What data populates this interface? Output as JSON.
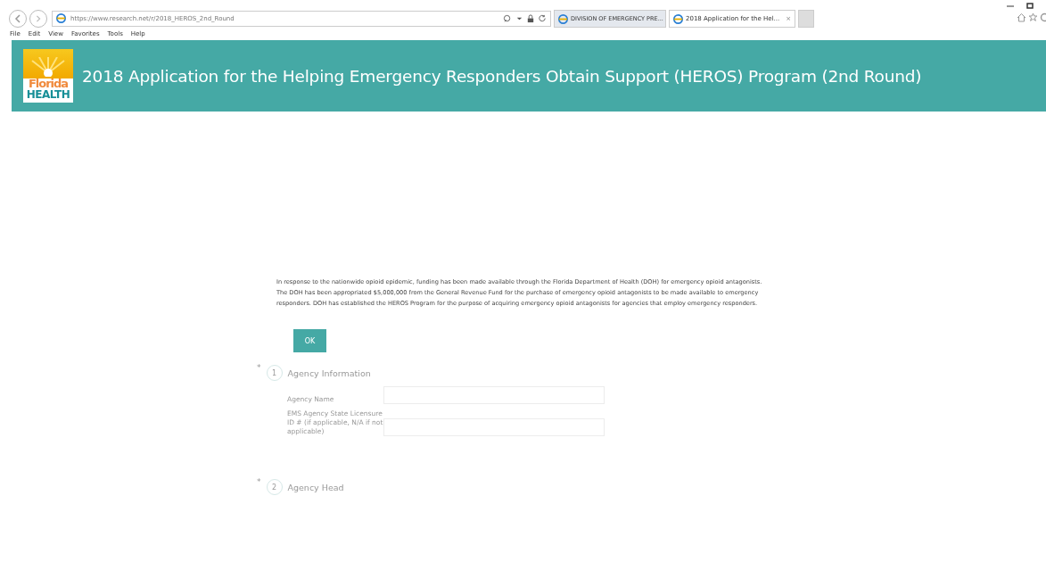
{
  "browser": {
    "url": "https://www.research.net/r/2018_HEROS_2nd_Round",
    "tabs": [
      {
        "label": "DIVISION OF EMERGENCY PRE...",
        "selected": false
      },
      {
        "label": "2018 Application for the Hel...",
        "selected": true
      }
    ],
    "close_tab": "×",
    "menu": [
      "File",
      "Edit",
      "View",
      "Favorites",
      "Tools",
      "Help"
    ]
  },
  "header": {
    "logo_top": "Florida",
    "logo_bottom": "HEALTH",
    "title": "2018 Application for the Helping Emergency Responders Obtain Support (HEROS) Program (2nd Round)"
  },
  "notice": {
    "text": "In response to the nationwide opioid epidemic, funding has been made available through the Florida Department of Health (DOH) for emergency opioid antagonists. The DOH has been appropriated $5,000,000 from the General Revenue Fund for the purchase of emergency opioid antagonists to be made available to emergency responders. DOH has established the HEROS Program for the purpose of acquiring emergency opioid antagonists for agencies that employ emergency responders.",
    "button": "OK"
  },
  "sections": [
    {
      "required": "*",
      "number": "1",
      "title": "Agency Information",
      "fields": [
        {
          "label": "Agency Name"
        },
        {
          "label": "EMS Agency State Licensure ID # (if applicable, N/A if not applicable)"
        }
      ]
    },
    {
      "required": "*",
      "number": "2",
      "title": "Agency Head"
    }
  ]
}
